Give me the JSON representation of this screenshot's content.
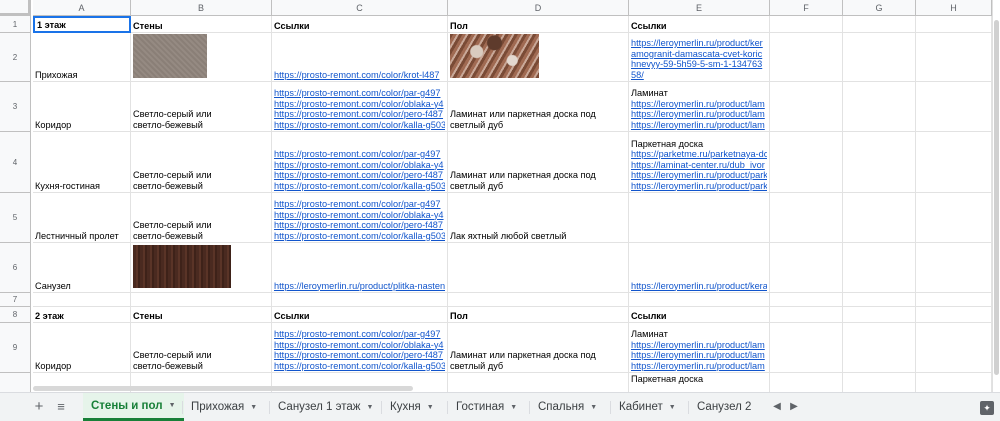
{
  "columns": [
    "A",
    "B",
    "C",
    "D",
    "E",
    "F",
    "G",
    "H"
  ],
  "rows": [
    {
      "num": "1",
      "cells": [
        [
          "1 этаж"
        ],
        [
          "Стены"
        ],
        [
          "Ссылки"
        ],
        [
          "Пол"
        ],
        [
          "Ссылки"
        ],
        [],
        [],
        []
      ]
    },
    {
      "num": "2",
      "cells": [
        [
          "Прихожая"
        ],
        [
          "[image]"
        ],
        [
          "https://prosto-remont.com/color/krot-l487"
        ],
        [
          "[image]"
        ],
        [
          "https://leroymerlin.ru/product/ker",
          "amogranit-damascata-cvet-koric",
          "hnevyy-59-5h59-5-sm-1-134763",
          "58/"
        ],
        [],
        [],
        []
      ]
    },
    {
      "num": "3",
      "cells": [
        [
          "Коридор"
        ],
        [
          "Светло-серый или",
          "светло-бежевый"
        ],
        [
          "https://prosto-remont.com/color/par-g497",
          "https://prosto-remont.com/color/oblaka-y4",
          "https://prosto-remont.com/color/pero-f487",
          "https://prosto-remont.com/color/kalla-g503"
        ],
        [
          "Ламинат или паркетная доска под",
          "светлый дуб"
        ],
        [
          "Ламинат",
          "https://leroymerlin.ru/product/lam",
          "https://leroymerlin.ru/product/lam",
          "https://leroymerlin.ru/product/lam"
        ],
        [],
        [],
        []
      ]
    },
    {
      "num": "4",
      "cells": [
        [
          "Кухня-гостиная"
        ],
        [
          "Светло-серый или",
          "светло-бежевый"
        ],
        [
          "https://prosto-remont.com/color/par-g497",
          "https://prosto-remont.com/color/oblaka-y4",
          "https://prosto-remont.com/color/pero-f487",
          "https://prosto-remont.com/color/kalla-g503"
        ],
        [
          "Ламинат или паркетная доска под",
          "светлый дуб"
        ],
        [
          "Паркетная доска",
          "https://parketme.ru/parketnaya-do",
          "https://laminat-center.ru/dub_ivor",
          "https://leroymerlin.ru/product/park",
          "https://leroymerlin.ru/product/park"
        ],
        [],
        [],
        []
      ]
    },
    {
      "num": "5",
      "cells": [
        [
          "Лестничный пролет"
        ],
        [
          "Светло-серый или",
          "светло-бежевый"
        ],
        [
          "https://prosto-remont.com/color/par-g497",
          "https://prosto-remont.com/color/oblaka-y4",
          "https://prosto-remont.com/color/pero-f487",
          "https://prosto-remont.com/color/kalla-g503"
        ],
        [
          "Лак яхтный любой светлый"
        ],
        [],
        [],
        [],
        []
      ]
    },
    {
      "num": "6",
      "cells": [
        [
          "Санузел"
        ],
        [
          "[image]"
        ],
        [
          "https://leroymerlin.ru/product/plitka-nasten"
        ],
        [],
        [
          "https://leroymerlin.ru/product/kera"
        ],
        [],
        [],
        []
      ]
    },
    {
      "num": "7",
      "cells": [
        [],
        [],
        [],
        [],
        [],
        [],
        [],
        []
      ]
    },
    {
      "num": "8",
      "cells": [
        [
          "2 этаж"
        ],
        [
          "Стены"
        ],
        [
          "Ссылки"
        ],
        [
          "Пол"
        ],
        [
          "Ссылки"
        ],
        [],
        [],
        []
      ]
    },
    {
      "num": "9",
      "cells": [
        [
          "Коридор"
        ],
        [
          "Светло-серый или",
          "светло-бежевый"
        ],
        [
          "https://prosto-remont.com/color/par-g497",
          "https://prosto-remont.com/color/oblaka-y4",
          "https://prosto-remont.com/color/pero-f487",
          "https://prosto-remont.com/color/kalla-g503"
        ],
        [
          "Ламинат или паркетная доска под",
          "светлый дуб"
        ],
        [
          "Ламинат",
          "https://leroymerlin.ru/product/lam",
          "https://leroymerlin.ru/product/lam",
          "https://leroymerlin.ru/product/lam"
        ],
        [],
        [],
        []
      ]
    },
    {
      "num": "",
      "cells": [
        [],
        [],
        [],
        [],
        [
          "Паркетная доска"
        ],
        [],
        [],
        []
      ]
    }
  ],
  "tabs": [
    {
      "label": "Стены и пол",
      "active": true
    },
    {
      "label": "Прихожая"
    },
    {
      "label": "Санузел 1 этаж"
    },
    {
      "label": "Кухня"
    },
    {
      "label": "Гостиная"
    },
    {
      "label": "Спальня"
    },
    {
      "label": "Кабинет"
    },
    {
      "label": "Санузел 2"
    }
  ],
  "toolbar": {
    "add_sheet": "+",
    "all_sheets": "≡",
    "prev": "◀",
    "next": "▶",
    "explore": "✦"
  },
  "colors": {
    "link": "#1155cc",
    "active_tab": "#188038",
    "active_tab_bg": "#e6f4ea",
    "selection": "#1a73e8"
  }
}
